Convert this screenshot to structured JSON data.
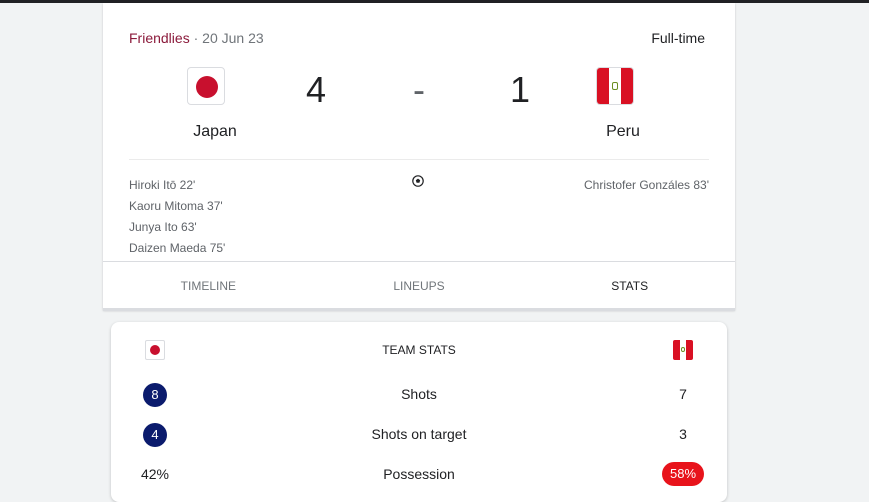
{
  "match": {
    "competition": "Friendlies",
    "separator": "·",
    "date": "20 Jun 23",
    "status": "Full-time",
    "dash": "-",
    "home": {
      "name": "Japan",
      "score": "4",
      "flag_icon": "japan-flag-icon"
    },
    "away": {
      "name": "Peru",
      "score": "1",
      "flag_icon": "peru-flag-icon"
    },
    "home_scorers": [
      "Hiroki Itō 22'",
      "Kaoru Mitoma 37'",
      "Junya Ito 63'",
      "Daizen Maeda 75'"
    ],
    "away_scorers": [
      "Christofer Gonzáles 83'"
    ],
    "goal_icon": "soccer-ball-icon"
  },
  "tabs": [
    {
      "label": "TIMELINE",
      "active": false
    },
    {
      "label": "LINEUPS",
      "active": false
    },
    {
      "label": "STATS",
      "active": true
    }
  ],
  "stats": {
    "header": "TEAM STATS",
    "rows": [
      {
        "label": "Shots",
        "home": "8",
        "away": "7"
      },
      {
        "label": "Shots on target",
        "home": "4",
        "away": "3"
      },
      {
        "label": "Possession",
        "home": "42%",
        "away": "58%"
      }
    ]
  },
  "colors": {
    "competition": "#8b1a3b",
    "japan_red": "#c8102e",
    "peru_red": "#d91023",
    "highlight_navy": "#0b1b6d",
    "highlight_red": "#e8131b"
  }
}
